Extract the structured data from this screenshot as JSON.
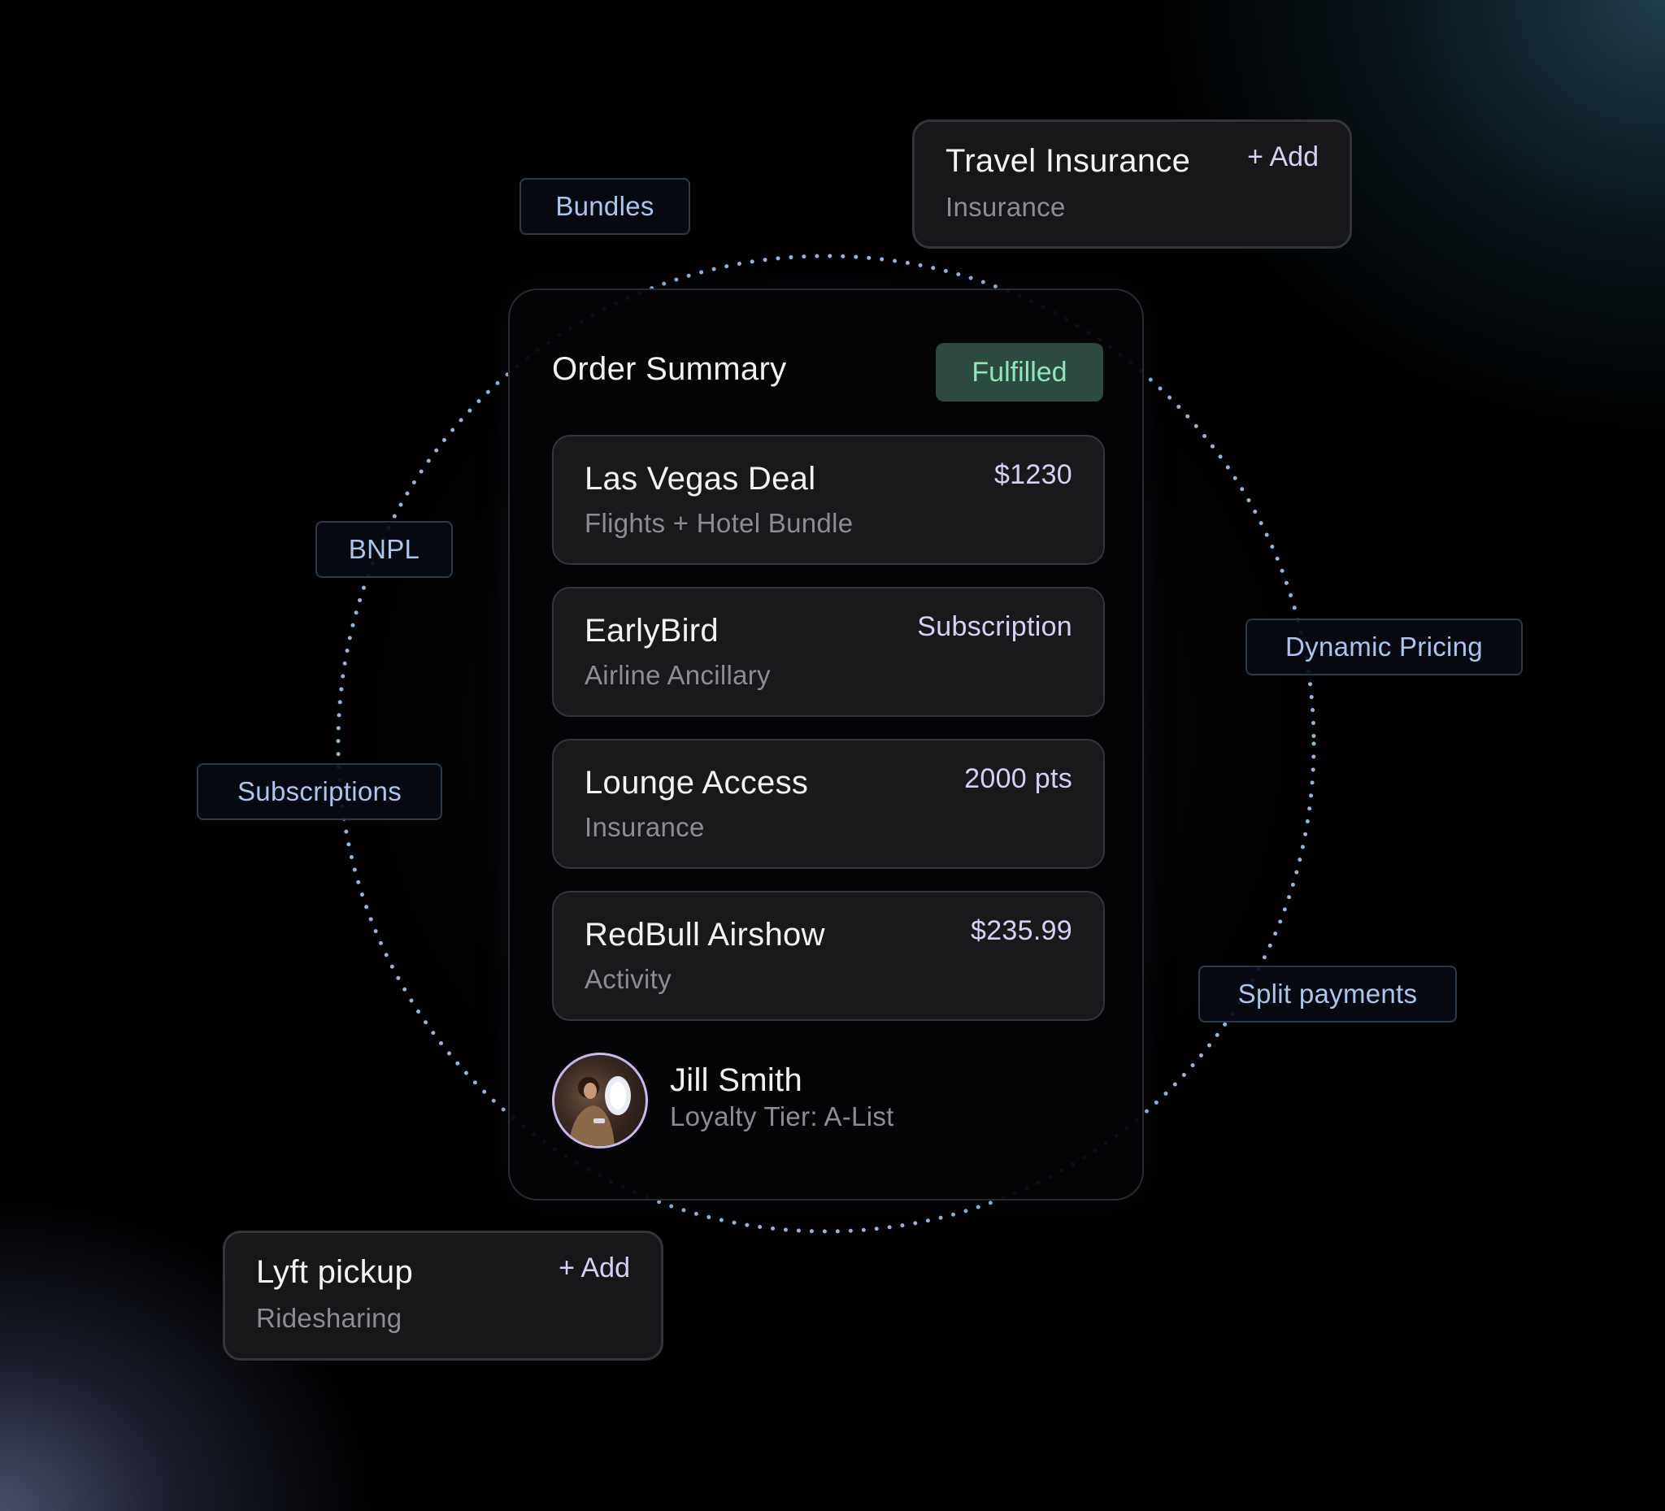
{
  "order_summary": {
    "title": "Order Summary",
    "status": "Fulfilled",
    "items": [
      {
        "name": "Las Vegas Deal",
        "subtitle": "Flights + Hotel Bundle",
        "value": "$1230"
      },
      {
        "name": "EarlyBird",
        "subtitle": "Airline Ancillary",
        "value": "Subscription"
      },
      {
        "name": "Lounge Access",
        "subtitle": "Insurance",
        "value": "2000 pts"
      },
      {
        "name": "RedBull Airshow",
        "subtitle": "Activity",
        "value": "$235.99"
      }
    ],
    "customer": {
      "name": "Jill Smith",
      "tier": "Loyalty Tier: A-List"
    }
  },
  "tags": {
    "bundles": "Bundles",
    "bnpl": "BNPL",
    "subscriptions": "Subscriptions",
    "dynamic_pricing": "Dynamic Pricing",
    "split_payments": "Split payments"
  },
  "addons": {
    "travel_insurance": {
      "name": "Travel Insurance",
      "subtitle": "Insurance",
      "action": "+ Add"
    },
    "lyft_pickup": {
      "name": "Lyft pickup",
      "subtitle": "Ridesharing",
      "action": "+ Add"
    }
  },
  "colors": {
    "background": "#000000",
    "status_badge_bg": "#2c4a3f",
    "status_badge_text": "#8fe7b9",
    "tag_text": "#a9c6ee",
    "accent_value": "#d8cff5",
    "dotted_ring": "#8fb8e0"
  }
}
